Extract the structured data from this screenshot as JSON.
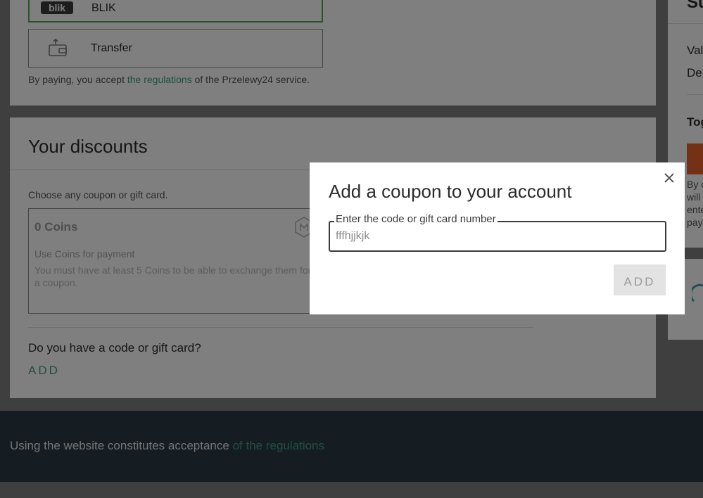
{
  "payment": {
    "blik_logo": "blik",
    "blik_label": "BLIK",
    "transfer_label": "Transfer",
    "consent_prefix": "By paying, you accept ",
    "consent_link": "the regulations",
    "consent_suffix": " of the Przelewy24 service."
  },
  "discounts": {
    "title": "Your discounts",
    "choose_text": "Choose any coupon or gift card.",
    "coins_card": {
      "title": "0 Coins",
      "subtitle": "Use Coins for payment",
      "description": "You must have at least 5 Coins to be able to exchange them for a coupon."
    },
    "code_question": "Do you have a code or gift card?",
    "add_link": "ADD"
  },
  "summary": {
    "title_partial": "Su",
    "value_partial": "Val",
    "delivery_partial": "Del",
    "total_partial": "Tog",
    "terms_lines": [
      "By c",
      "will",
      "ente",
      "pay"
    ]
  },
  "footer": {
    "text": "Using the website constitutes acceptance ",
    "link": "of the regulations"
  },
  "modal": {
    "title": "Add a coupon to your account",
    "field_label": "Enter the code or gift card number",
    "field_value": "fffhjjkjk",
    "add_button": "ADD"
  },
  "colors": {
    "accent_green": "#3fa07a",
    "selected_border": "#4caf50",
    "orange_button": "#e8622c",
    "footer_bg": "#2d3a45"
  },
  "icons": [
    "blik-logo",
    "wallet-transfer-icon",
    "coins-icon",
    "close-icon",
    "spinner-icon"
  ]
}
